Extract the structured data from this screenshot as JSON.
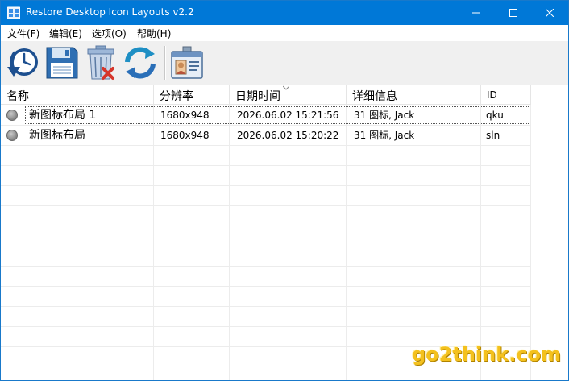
{
  "window": {
    "title": "Restore Desktop Icon Layouts v2.2"
  },
  "menu": {
    "items": [
      "文件(F)",
      "编辑(E)",
      "选项(O)",
      "帮助(H)"
    ]
  },
  "toolbar": {
    "buttons": [
      {
        "name": "restore-icon-layout-button",
        "icon": "clock-restore-icon"
      },
      {
        "name": "save-layout-button",
        "icon": "floppy-disk-icon"
      },
      {
        "name": "delete-layout-button",
        "icon": "trash-delete-icon"
      },
      {
        "name": "refresh-button",
        "icon": "refresh-arrows-icon"
      },
      {
        "name": "about-button",
        "icon": "id-card-icon"
      }
    ]
  },
  "list": {
    "columns": [
      "名称",
      "分辨率",
      "日期时间",
      "详细信息",
      "ID"
    ],
    "sorted_column": "日期时间",
    "rows": [
      {
        "name": "新图标布局 1",
        "resolution": "1680x948",
        "datetime": "2026.06.02 15:21:56",
        "details": "31 图标, Jack",
        "id": "qku",
        "focused": true
      },
      {
        "name": "新图标布局",
        "resolution": "1680x948",
        "datetime": "2026.06.02 15:20:22",
        "details": "31 图标, Jack",
        "id": "sln",
        "focused": false
      }
    ]
  },
  "watermark": "go2think.com",
  "colors": {
    "titlebar": "#0078d7",
    "watermark": "#f4c11e"
  }
}
